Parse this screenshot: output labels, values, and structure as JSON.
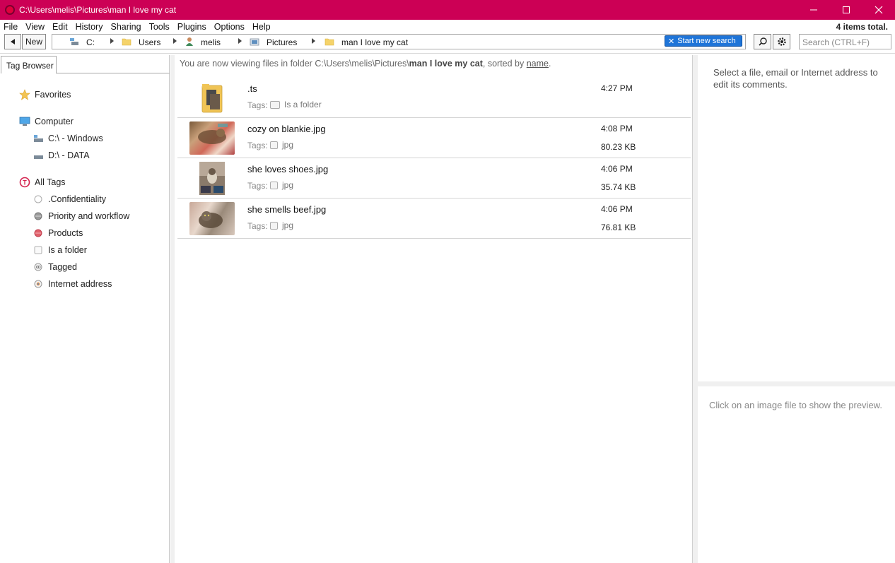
{
  "window": {
    "title": "C:\\Users\\melis\\Pictures\\man I love my cat",
    "controls": [
      "—",
      "☐",
      "✕"
    ]
  },
  "menu": {
    "items": [
      "File",
      "View",
      "Edit",
      "History",
      "Sharing",
      "Tools",
      "Plugins",
      "Options",
      "Help"
    ],
    "items_total": "4 items total."
  },
  "toolbar": {
    "new_label": "New",
    "breadcrumbs": [
      "C:",
      "Users",
      "melis",
      "Pictures",
      "man I love my cat"
    ],
    "start_search_label": "Start new search",
    "search_placeholder": "Search (CTRL+F)"
  },
  "left_panel": {
    "tab_label": "Tag Browser",
    "favorites": "Favorites",
    "computer": "Computer",
    "drives": [
      "C:\\ - Windows",
      "D:\\ - DATA"
    ],
    "all_tags": "All Tags",
    "tags": [
      ".Confidentiality",
      "Priority and workflow",
      "Products",
      "Is a folder",
      "Tagged",
      "Internet address"
    ]
  },
  "center": {
    "viewing_prefix": "You are now viewing files in folder C:\\Users\\melis\\Pictures\\",
    "viewing_folder": "man I love my cat",
    "viewing_sorted": ", sorted by ",
    "viewing_sort_key": "name",
    "viewing_end": ".",
    "tags_label": "Tags:",
    "files": [
      {
        "name": ".ts",
        "tag": "Is a folder",
        "time": "4:27 PM",
        "size": ""
      },
      {
        "name": "cozy on blankie.jpg",
        "tag": "jpg",
        "time": "4:08 PM",
        "size": "80.23 KB"
      },
      {
        "name": "she loves shoes.jpg",
        "tag": "jpg",
        "time": "4:06 PM",
        "size": "35.74 KB"
      },
      {
        "name": "she smells beef.jpg",
        "tag": "jpg",
        "time": "4:06 PM",
        "size": "76.81 KB"
      }
    ]
  },
  "right_panel": {
    "comments_hint": "Select a file, email or Internet address to edit its comments.",
    "preview_hint": "Click on an image file to show the preview."
  },
  "colors": {
    "titlebar": "#cc0055",
    "search_button": "#1e74d8"
  }
}
